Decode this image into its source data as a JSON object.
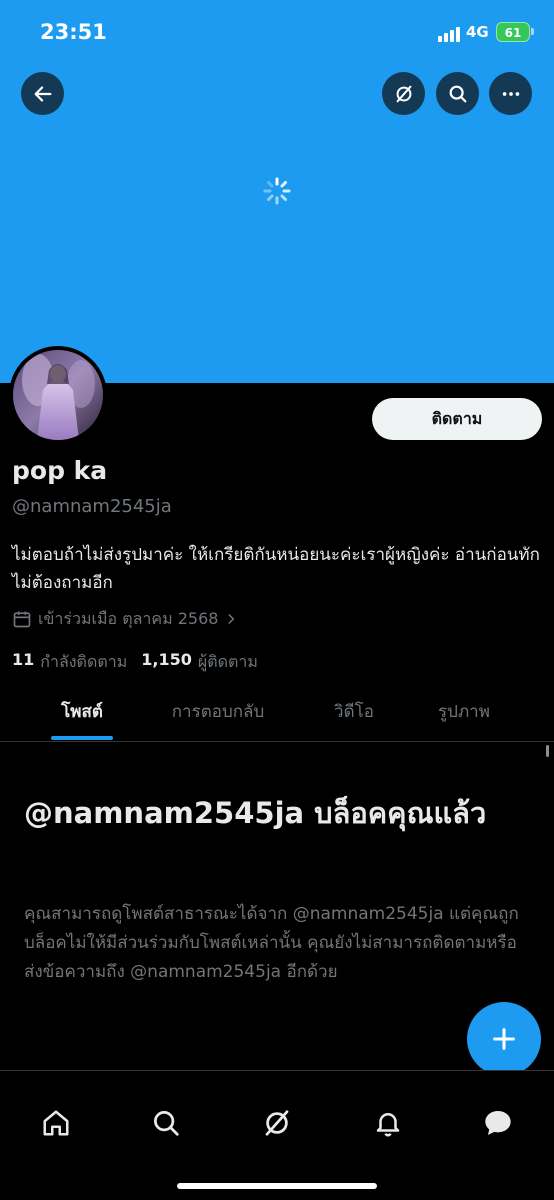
{
  "status_bar": {
    "time": "23:51",
    "network": "4G",
    "battery": "61"
  },
  "profile": {
    "display_name": "pop ka",
    "handle": "@namnam2545ja",
    "bio": "ไม่ตอบถ้าไม่ส่งรูปมาค่ะ ให้เกรียติกันหน่อยนะค่ะเราผู้หญิงค่ะ อ่านก่อนทักไม่ต้องถามอีก",
    "joined": "เข้าร่วมเมือ ตุลาคม 2568",
    "following_count": "11",
    "following_label": "กำลังติดตาม",
    "followers_count": "1,150",
    "followers_label": "ผู้ติดตาม",
    "follow_button": "ติดตาม"
  },
  "tabs": [
    "โพสต์",
    "การตอบกลับ",
    "วิดีโอ",
    "รูปภาพ"
  ],
  "blocked": {
    "title": "@namnam2545ja บล็อคคุณแล้ว",
    "message": "คุณสามารถดูโพสต์สาธารณะได้จาก @namnam2545ja แต่คุณถูกบล็อคไม่ให้มีส่วนร่วมกับโพสต์เหล่านั้น คุณยังไม่สามารถติดตามหรือส่งข้อความถึง @namnam2545ja อีกด้วย"
  },
  "colors": {
    "accent": "#1d9bf0",
    "background": "#000000",
    "muted": "#71767b"
  }
}
